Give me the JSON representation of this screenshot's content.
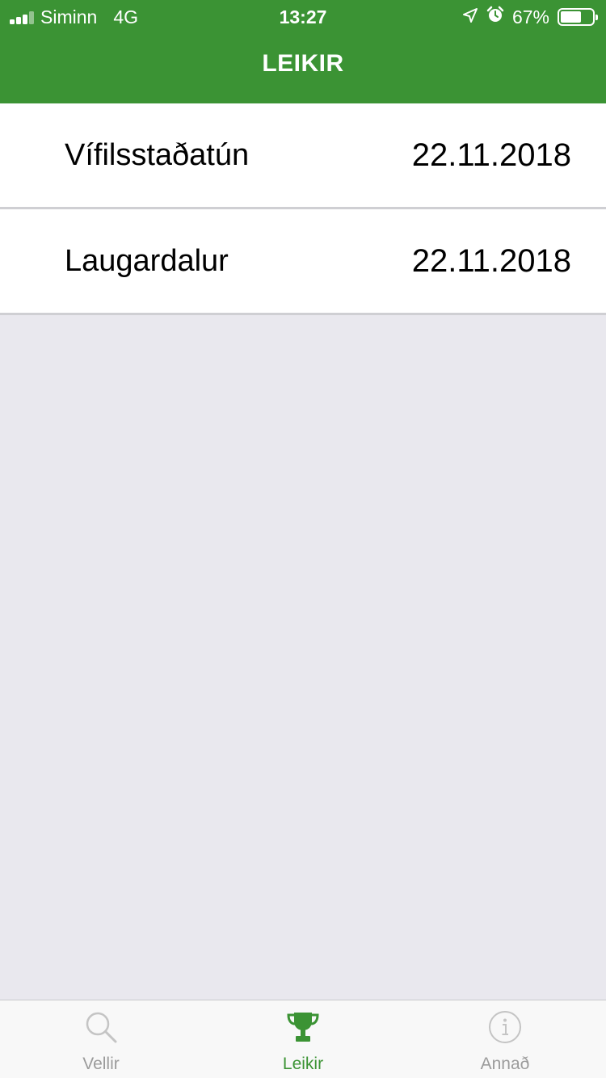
{
  "status_bar": {
    "carrier": "Siminn",
    "network": "4G",
    "time": "13:27",
    "battery_percent": "67%",
    "battery_level": 0.67,
    "icons": [
      "signal-icon",
      "location-arrow-icon",
      "alarm-clock-icon",
      "battery-icon"
    ]
  },
  "nav": {
    "title": "LEIKIR"
  },
  "games": [
    {
      "name": "Vífilsstaðatún",
      "date": "22.11.2018"
    },
    {
      "name": "Laugardalur",
      "date": "22.11.2018"
    }
  ],
  "tabs": [
    {
      "label": "Vellir",
      "icon": "search-icon",
      "active": false
    },
    {
      "label": "Leikir",
      "icon": "trophy-icon",
      "active": true
    },
    {
      "label": "Annað",
      "icon": "info-icon",
      "active": false
    }
  ],
  "colors": {
    "accent": "#3b9334",
    "background": "#e9e8ee",
    "inactive": "#9b9b9b"
  }
}
